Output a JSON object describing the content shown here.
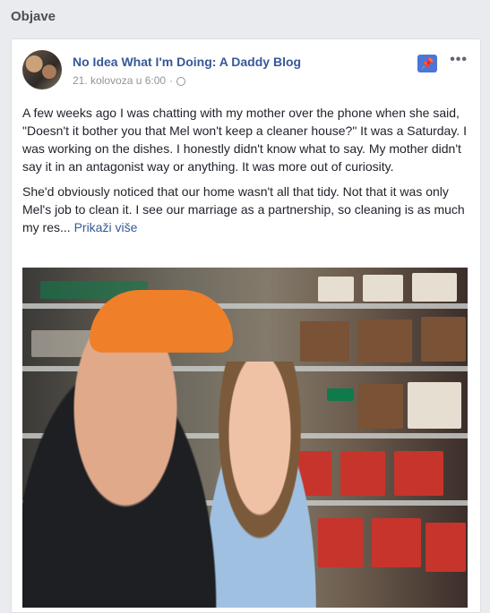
{
  "section": {
    "title": "Objave"
  },
  "post": {
    "page_name": "No Idea What I'm Doing: A Daddy Blog",
    "date": "21. kolovoza u 6:00",
    "meta_separator": "·",
    "paragraphs": [
      "A few weeks ago I was chatting with my mother over the phone when she said, \"Doesn't it bother you that Mel won't keep a cleaner house?\" It was a Saturday. I was working on the dishes. I honestly didn't know what to say. My mother didn't say it in an antagonist way or anything. It was more out of curiosity.",
      "She'd obviously noticed that our home wasn't all that tidy. Not that it was only Mel's job to clean it. I see our marriage as a partnership, so cleaning is as much my res... "
    ],
    "see_more": "Prikaži više",
    "icons": {
      "pin": "pin-icon",
      "more": "more-icon",
      "audience": "globe-icon"
    },
    "colors": {
      "link": "#365899",
      "pin_bg": "#4a76d9",
      "meta": "#90949c"
    }
  }
}
